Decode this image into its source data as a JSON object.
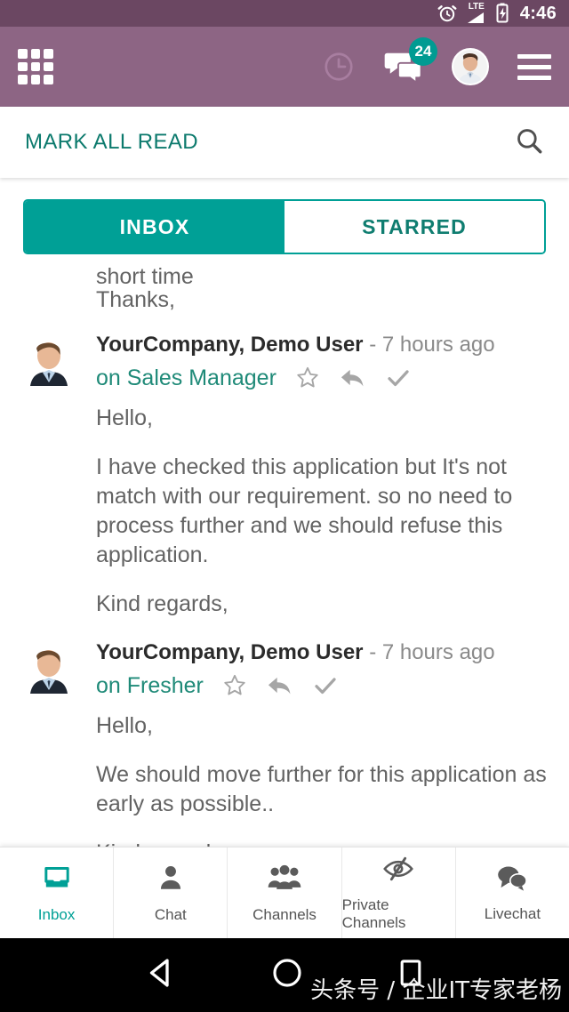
{
  "statusbar": {
    "alarm_icon": "alarm-clock-icon",
    "network_label": "LTE",
    "signal_icon": "signal-bars-icon",
    "battery_icon": "battery-charging-icon",
    "time": "4:46"
  },
  "appbar": {
    "apps_icon": "apps-grid-icon",
    "history_icon": "clock-history-icon",
    "messages_icon": "chat-bubbles-icon",
    "messages_badge": "24",
    "avatar_icon": "user-avatar",
    "menu_icon": "hamburger-menu-icon",
    "background": "#8d6584"
  },
  "toolbar": {
    "mark_all_read_label": "MARK ALL READ",
    "search_icon": "search-icon",
    "accent": "#0c7a6d"
  },
  "tabs": [
    {
      "label": "INBOX",
      "active": true
    },
    {
      "label": "STARRED",
      "active": false
    }
  ],
  "clipped_message": {
    "line1": "short time",
    "line2": "Thanks,"
  },
  "messages": [
    {
      "author": "YourCompany, Demo User",
      "time": "- 7 hours ago",
      "topic": "on Sales Manager",
      "star_icon": "star-outline-icon",
      "reply_icon": "reply-arrow-icon",
      "check_icon": "check-mark-icon",
      "paragraphs": [
        "Hello,",
        "I have checked this application but It's not match with our requirement. so no need to process further and we should refuse this application.",
        "Kind regards,"
      ]
    },
    {
      "author": "YourCompany, Demo User",
      "time": "- 7 hours ago",
      "topic": "on Fresher",
      "star_icon": "star-outline-icon",
      "reply_icon": "reply-arrow-icon",
      "check_icon": "check-mark-icon",
      "paragraphs": [
        "Hello,",
        "We should move further for this application as early as possible..",
        "Kind regards,"
      ]
    }
  ],
  "bottom_nav": [
    {
      "label": "Inbox",
      "icon": "inbox-tray-icon",
      "active": true
    },
    {
      "label": "Chat",
      "icon": "person-icon",
      "active": false
    },
    {
      "label": "Channels",
      "icon": "people-group-icon",
      "active": false
    },
    {
      "label": "Private Channels",
      "icon": "eye-slash-icon",
      "active": false
    },
    {
      "label": "Livechat",
      "icon": "chat-bubbles-icon",
      "active": false
    }
  ],
  "android_nav": {
    "back_icon": "back-triangle-icon",
    "home_icon": "home-circle-icon",
    "recents_icon": "recents-square-icon",
    "watermark": "头条号 / 企业IT专家老杨"
  },
  "colors": {
    "accent_teal": "#00a096",
    "appbar_purple": "#8d6584",
    "statusbar_purple": "#6b4762",
    "link_teal": "#1f8a78"
  }
}
